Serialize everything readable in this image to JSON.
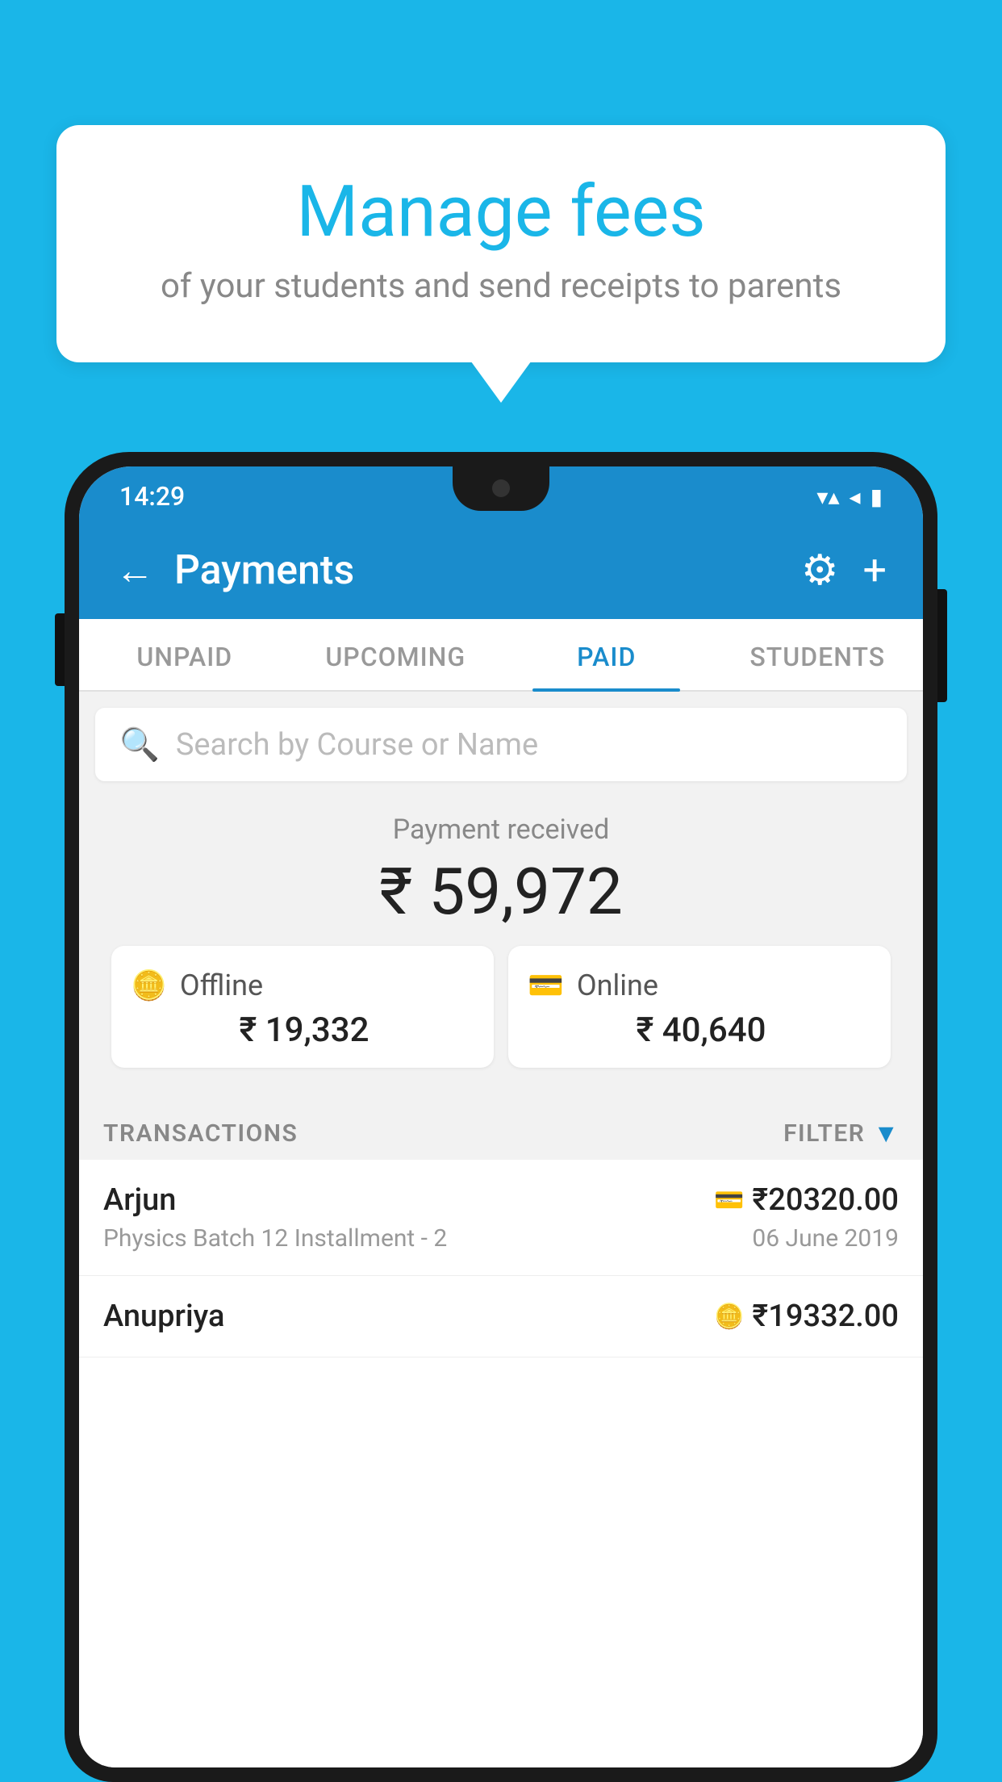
{
  "background_color": "#1ab6e8",
  "bubble": {
    "title": "Manage fees",
    "subtitle": "of your students and send receipts to parents"
  },
  "status_bar": {
    "time": "14:29",
    "wifi": "▼▲",
    "signal": "◀",
    "battery": "▮"
  },
  "header": {
    "title": "Payments",
    "back_label": "←",
    "settings_label": "⚙",
    "add_label": "+"
  },
  "tabs": [
    {
      "label": "UNPAID",
      "active": false
    },
    {
      "label": "UPCOMING",
      "active": false
    },
    {
      "label": "PAID",
      "active": true
    },
    {
      "label": "STUDENTS",
      "active": false
    }
  ],
  "search": {
    "placeholder": "Search by Course or Name"
  },
  "payment_summary": {
    "label": "Payment received",
    "total": "₹ 59,972",
    "offline_label": "Offline",
    "offline_amount": "₹ 19,332",
    "online_label": "Online",
    "online_amount": "₹ 40,640"
  },
  "transactions": {
    "section_label": "TRANSACTIONS",
    "filter_label": "FILTER",
    "rows": [
      {
        "name": "Arjun",
        "detail": "Physics Batch 12 Installment - 2",
        "amount": "₹20320.00",
        "date": "06 June 2019",
        "type": "online"
      },
      {
        "name": "Anupriya",
        "detail": "",
        "amount": "₹19332.00",
        "date": "",
        "type": "offline"
      }
    ]
  }
}
